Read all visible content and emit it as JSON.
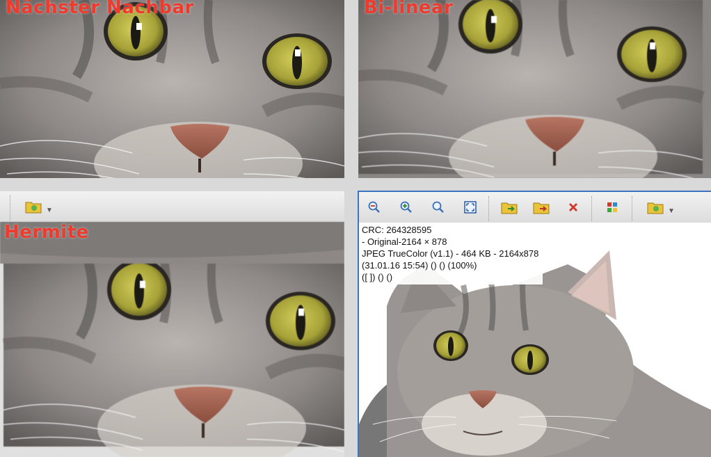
{
  "panes": {
    "nearest": {
      "label": "Nächster Nachbar"
    },
    "bilinear": {
      "label": "Bi-linear"
    },
    "hermite": {
      "label": "Hermite"
    }
  },
  "viewer": {
    "info": {
      "crc": "CRC: 264328595",
      "original": "- Original-2164 × 878",
      "format": "JPEG TrueColor (v1.1) - 464 KB - 2164x878",
      "date": "(31.01.16 15:54) () () (100%)",
      "extra": "([ ]) () ()"
    },
    "toolbar": [
      "zoom-out-icon",
      "zoom-in-icon",
      "zoom-original-icon",
      "fit-window-icon",
      "copy-to-folder-icon",
      "move-to-folder-icon",
      "delete-icon",
      "color-palette-icon",
      "open-folder-icon"
    ]
  },
  "colors": {
    "label": "#f03a2e",
    "eye": "#a7a238",
    "nose": "#a86654",
    "fur": "#8a8684",
    "toolbar": "#e6e6e6",
    "selection_border": "#3c74c4"
  }
}
